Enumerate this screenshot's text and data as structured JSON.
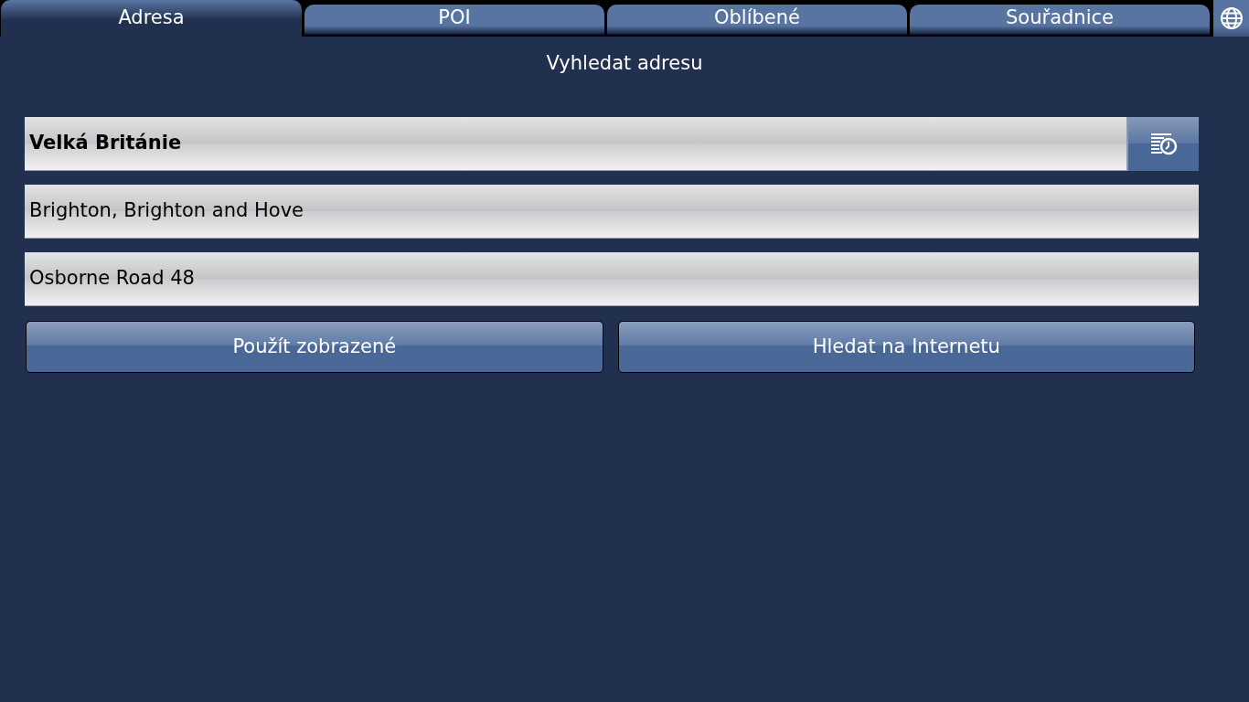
{
  "tabs": [
    {
      "label": "Adresa",
      "selected": true
    },
    {
      "label": "POI",
      "selected": false
    },
    {
      "label": "Oblíbené",
      "selected": false
    },
    {
      "label": "Souřadnice",
      "selected": false
    }
  ],
  "heading": "Vyhledat adresu",
  "fields": [
    {
      "kind": "country",
      "value": "Velká Británie"
    },
    {
      "kind": "city",
      "value": "Brighton, Brighton and Hove"
    },
    {
      "kind": "street",
      "value": "Osborne Road 48"
    }
  ],
  "buttons": [
    "Použít zobrazené",
    "Hledat na Internetu"
  ]
}
